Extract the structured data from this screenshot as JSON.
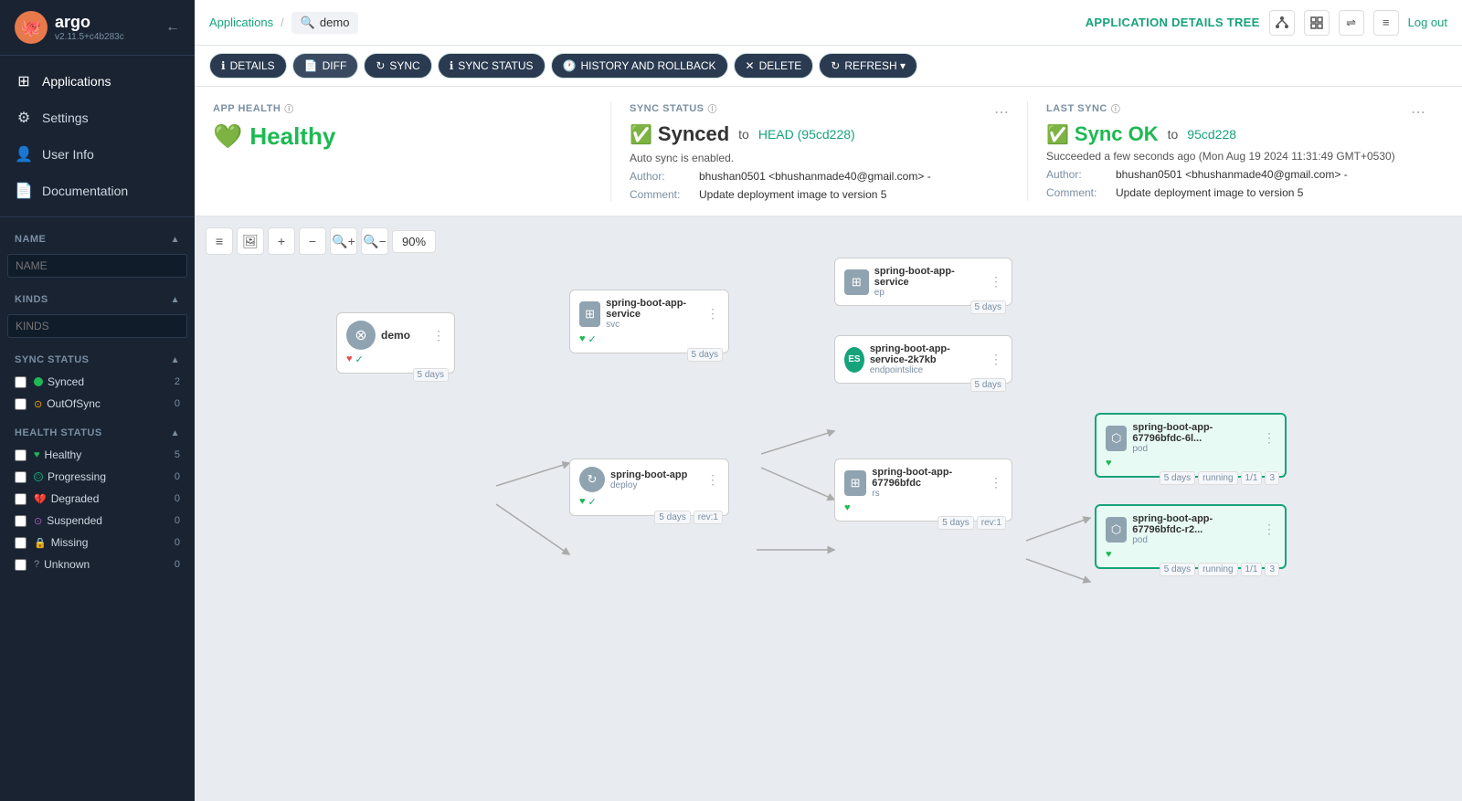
{
  "sidebar": {
    "logo": "🐙",
    "app_name": "argo",
    "version": "v2.11.5+c4b283c",
    "back_icon": "←",
    "nav_items": [
      {
        "id": "applications",
        "label": "Applications",
        "icon": "⊞",
        "active": true
      },
      {
        "id": "settings",
        "label": "Settings",
        "icon": "⚙"
      },
      {
        "id": "user-info",
        "label": "User Info",
        "icon": "👤"
      },
      {
        "id": "documentation",
        "label": "Documentation",
        "icon": "📄"
      }
    ],
    "name_filter": {
      "label": "NAME",
      "placeholder": "NAME"
    },
    "kinds_filter": {
      "label": "KINDS",
      "placeholder": "KINDS"
    },
    "sync_status": {
      "label": "SYNC STATUS",
      "items": [
        {
          "id": "synced",
          "label": "Synced",
          "count": 2,
          "color": "green"
        },
        {
          "id": "outofSync",
          "label": "OutOfSync",
          "count": 0,
          "color": "yellow"
        }
      ]
    },
    "health_status": {
      "label": "HEALTH STATUS",
      "items": [
        {
          "id": "healthy",
          "label": "Healthy",
          "count": 5,
          "color": "green"
        },
        {
          "id": "progressing",
          "label": "Progressing",
          "count": 0,
          "color": "teal"
        },
        {
          "id": "degraded",
          "label": "Degraded",
          "count": 0,
          "color": "red"
        },
        {
          "id": "suspended",
          "label": "Suspended",
          "count": 0,
          "color": "purple"
        },
        {
          "id": "missing",
          "label": "Missing",
          "count": 0,
          "color": "yellow"
        },
        {
          "id": "unknown",
          "label": "Unknown",
          "count": 0,
          "color": "gray"
        }
      ]
    }
  },
  "topbar": {
    "breadcrumb_applications": "Applications",
    "breadcrumb_search_icon": "🔍",
    "breadcrumb_current": "demo",
    "app_details_tree": "APPLICATION DETAILS TREE",
    "logout_label": "Log out",
    "view_icons": [
      "⊞",
      "▦",
      "⇌",
      "≡"
    ]
  },
  "action_bar": {
    "buttons": [
      {
        "id": "details",
        "label": "DETAILS",
        "icon": "ℹ"
      },
      {
        "id": "diff",
        "label": "DIFF",
        "icon": "📄"
      },
      {
        "id": "sync",
        "label": "SYNC",
        "icon": "↻"
      },
      {
        "id": "sync-status",
        "label": "SYNC STATUS",
        "icon": "ℹ"
      },
      {
        "id": "history",
        "label": "HISTORY AND ROLLBACK",
        "icon": "🕐"
      },
      {
        "id": "delete",
        "label": "DELETE",
        "icon": "✕"
      },
      {
        "id": "refresh",
        "label": "REFRESH ▾",
        "icon": "↻"
      }
    ]
  },
  "app_health": {
    "title": "APP HEALTH",
    "status": "Healthy",
    "icon": "💚"
  },
  "sync_status_panel": {
    "title": "SYNC STATUS",
    "status": "Synced",
    "to_text": "to",
    "commit": "HEAD (95cd228)",
    "auto_sync": "Auto sync is enabled.",
    "author_label": "Author:",
    "author_value": "bhushan0501 <bhushanmade40@gmail.com> -",
    "comment_label": "Comment:",
    "comment_value": "Update deployment image to version 5"
  },
  "last_sync": {
    "title": "LAST SYNC",
    "status": "Sync OK",
    "to_text": "to",
    "commit": "95cd228",
    "succeeded_text": "Succeeded a few seconds ago (Mon Aug 19 2024 11:31:49 GMT+0530)",
    "author_label": "Author:",
    "author_value": "bhushan0501 <bhushanmade40@gmail.com> -",
    "comment_label": "Comment:",
    "comment_value": "Update deployment image to version 5"
  },
  "canvas": {
    "zoom": "90%",
    "nodes": {
      "demo": {
        "name": "demo",
        "type": "",
        "age": "5 days"
      },
      "svc": {
        "name": "spring-boot-app-service",
        "type": "svc",
        "age": "5 days"
      },
      "ep": {
        "name": "spring-boot-app-service",
        "type": "ep",
        "age": "5 days"
      },
      "es": {
        "name": "spring-boot-app-service-2k7kb",
        "type": "endpointslice",
        "age": "5 days"
      },
      "deploy": {
        "name": "spring-boot-app",
        "type": "deploy",
        "age": "5 days",
        "rev": "rev:1"
      },
      "rs": {
        "name": "spring-boot-app-67796bfdc",
        "type": "rs",
        "age": "5 days",
        "rev": "rev:1"
      },
      "pod1": {
        "name": "spring-boot-app-67796bfdc-6l...",
        "type": "pod",
        "age": "5 days",
        "status": "running",
        "replicas": "1/1",
        "count": "3"
      },
      "pod2": {
        "name": "spring-boot-app-67796bfdc-r2...",
        "type": "pod",
        "age": "5 days",
        "status": "running",
        "replicas": "1/1",
        "count": "3"
      }
    }
  }
}
